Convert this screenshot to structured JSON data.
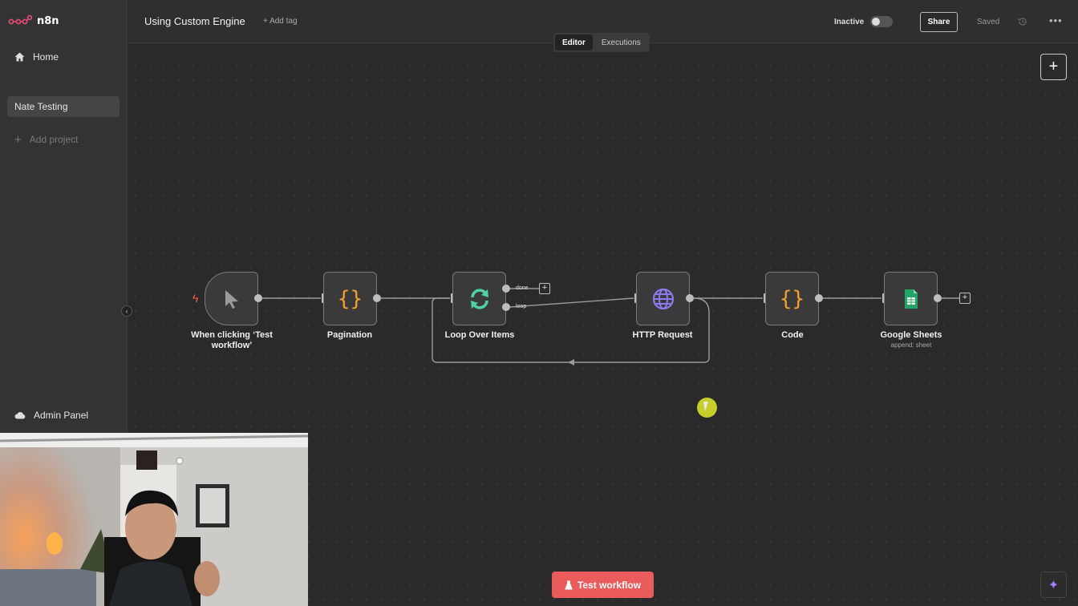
{
  "app": {
    "name": "n8n"
  },
  "sidebar": {
    "items": [
      {
        "label": "Home"
      },
      {
        "label": "Nate Testing"
      },
      {
        "label": "Add project"
      }
    ],
    "footer": {
      "label": "Admin Panel"
    }
  },
  "header": {
    "workflow_title": "Using Custom Engine",
    "add_tag": "+ Add tag",
    "status_label": "Inactive",
    "share_label": "Share",
    "saved_label": "Saved",
    "tabs": [
      {
        "label": "Editor",
        "active": true
      },
      {
        "label": "Executions",
        "active": false
      }
    ]
  },
  "workflow": {
    "nodes": [
      {
        "label": "When clicking ‘Test workflow’",
        "icon": "cursor-icon"
      },
      {
        "label": "Pagination",
        "icon": "code-braces-icon"
      },
      {
        "label": "Loop Over Items",
        "icon": "loop-icon",
        "outputs": [
          "done",
          "loop"
        ]
      },
      {
        "label": "HTTP Request",
        "icon": "globe-icon"
      },
      {
        "label": "Code",
        "icon": "code-braces-icon"
      },
      {
        "label": "Google Sheets",
        "subtitle": "append: sheet",
        "icon": "google-sheets-icon"
      }
    ]
  },
  "footer": {
    "test_button": "Test workflow"
  },
  "colors": {
    "accent": "#ea5b5b",
    "loop_icon": "#4fd1a5",
    "code_icon": "#f59e2e",
    "globe_icon": "#8a7cf0",
    "sheets_icon": "#23a566"
  }
}
